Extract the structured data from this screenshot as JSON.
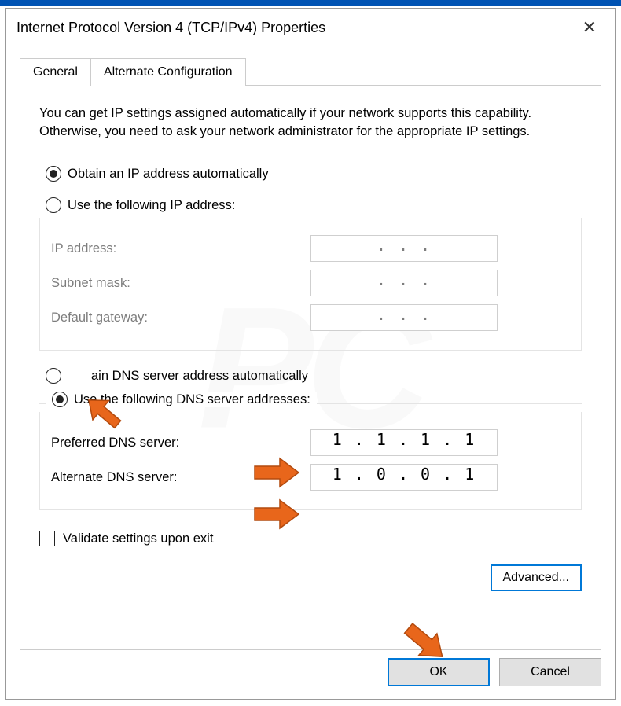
{
  "title": "Internet Protocol Version 4 (TCP/IPv4) Properties",
  "tabs": {
    "general": "General",
    "alternate": "Alternate Configuration"
  },
  "description": "You can get IP settings assigned automatically if your network supports this capability. Otherwise, you need to ask your network administrator for the appropriate IP settings.",
  "ip_section": {
    "obtain_auto": "Obtain an IP address automatically",
    "use_following": "Use the following IP address:",
    "ip_address_label": "IP address:",
    "subnet_label": "Subnet mask:",
    "gateway_label": "Default gateway:",
    "ip_address_value": ".       .       .",
    "subnet_value": ".       .       .",
    "gateway_value": ".       .       ."
  },
  "dns_section": {
    "obtain_auto": "ain DNS server address automatically",
    "obtain_auto_full": "Obtain DNS server address automatically",
    "use_following": "Use the following DNS server addresses:",
    "preferred_label": "Preferred DNS server:",
    "alternate_label": "Alternate DNS server:",
    "preferred_value": "1 . 1 . 1 . 1",
    "alternate_value": "1 . 0 . 0 . 1"
  },
  "validate_label": "Validate settings upon exit",
  "advanced_label": "Advanced...",
  "ok_label": "OK",
  "cancel_label": "Cancel"
}
